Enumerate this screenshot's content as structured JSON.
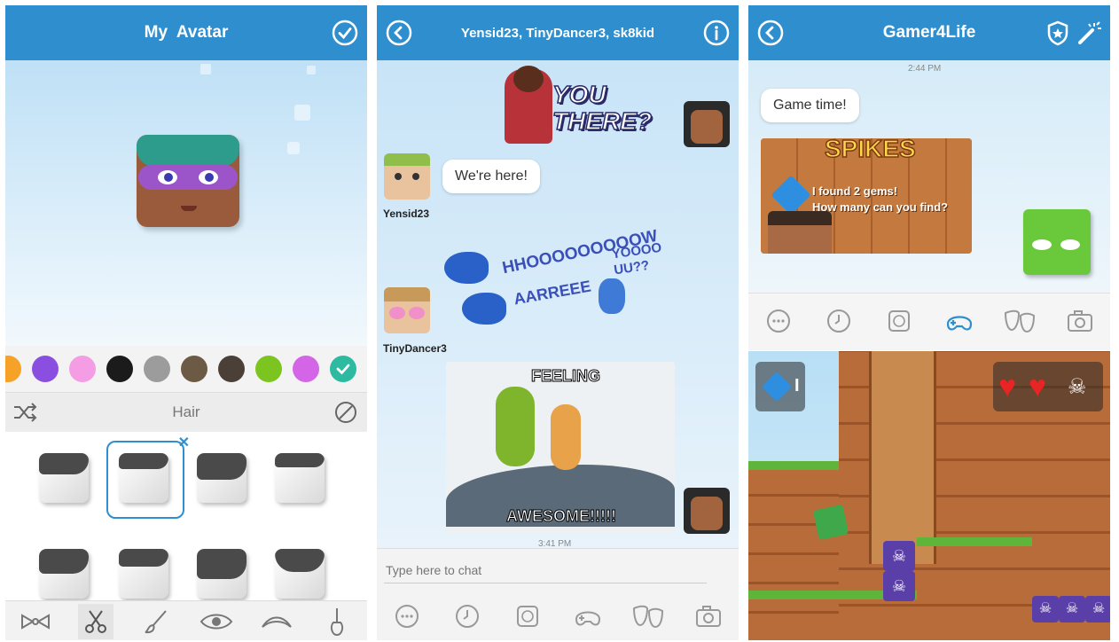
{
  "panel1": {
    "title": "My  Avatar",
    "confirm_icon": "check-circle-icon",
    "colors": [
      "#f6a128",
      "#8a4fe0",
      "#f49de4",
      "#1b1b1b",
      "#9c9c9c",
      "#6c5a44",
      "#4a4037",
      "#7cc41f",
      "#d365e6",
      "#2ebaa0"
    ],
    "category_label": "Hair",
    "shuffle_icon": "shuffle-icon",
    "none_icon": "no-sign-icon",
    "tabs": [
      "bow-tie-icon",
      "scissors-icon",
      "brush-icon",
      "eye-icon",
      "eyebrow-icon",
      "guitar-icon"
    ]
  },
  "panel2": {
    "title": "Yensid23, TinyDancer3, sk8kid",
    "back_icon": "back-arrow-icon",
    "info_icon": "info-icon",
    "sticker1_text": "YOU THERE?",
    "msg_text": "We're here!",
    "user1": "Yensid23",
    "sticker2_text_a": "HHOOOOOOOOOW",
    "sticker2_text_b": "AARREEE",
    "sticker2_text_c": "YOOOO UU??",
    "user2": "TinyDancer3",
    "meme_top": "FEELING",
    "meme_bottom": "AWESOME!!!!!",
    "timestamp": "3:41 PM",
    "input_placeholder": "Type here to chat",
    "tools": [
      "emoji-icon",
      "clock-icon",
      "sticker-icon",
      "game-controller-icon",
      "theater-masks-icon",
      "camera-icon"
    ]
  },
  "panel3": {
    "title": "Gamer4Life",
    "back_icon": "back-arrow-icon",
    "shield_icon": "shield-icon",
    "wand_icon": "magic-wand-icon",
    "timestamp": "2:44 PM",
    "msg_text": "Game time!",
    "game_title": "SPIKES",
    "game_line1": "I found 2 gems!",
    "game_line2": "How many can you find?",
    "tools": [
      "emoji-icon",
      "clock-icon",
      "sticker-icon",
      "game-controller-icon",
      "theater-masks-icon",
      "camera-icon"
    ],
    "active_tool_color": "#2f8fce",
    "gem_count": "I",
    "hearts": 2
  }
}
